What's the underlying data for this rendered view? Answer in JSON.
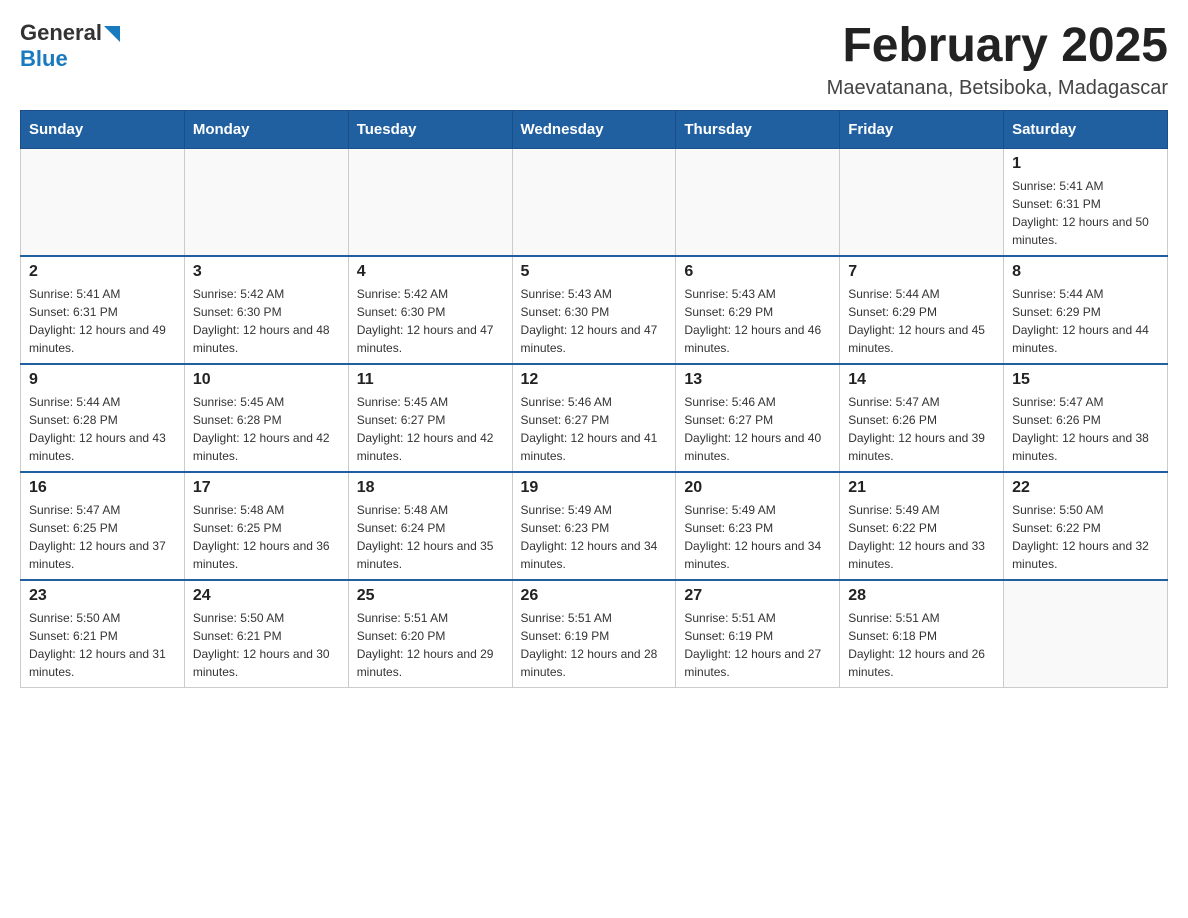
{
  "header": {
    "logo_general": "General",
    "logo_blue": "Blue",
    "title": "February 2025",
    "location": "Maevatanana, Betsiboka, Madagascar"
  },
  "weekdays": [
    "Sunday",
    "Monday",
    "Tuesday",
    "Wednesday",
    "Thursday",
    "Friday",
    "Saturday"
  ],
  "weeks": [
    [
      {
        "day": "",
        "sunrise": "",
        "sunset": "",
        "daylight": ""
      },
      {
        "day": "",
        "sunrise": "",
        "sunset": "",
        "daylight": ""
      },
      {
        "day": "",
        "sunrise": "",
        "sunset": "",
        "daylight": ""
      },
      {
        "day": "",
        "sunrise": "",
        "sunset": "",
        "daylight": ""
      },
      {
        "day": "",
        "sunrise": "",
        "sunset": "",
        "daylight": ""
      },
      {
        "day": "",
        "sunrise": "",
        "sunset": "",
        "daylight": ""
      },
      {
        "day": "1",
        "sunrise": "Sunrise: 5:41 AM",
        "sunset": "Sunset: 6:31 PM",
        "daylight": "Daylight: 12 hours and 50 minutes."
      }
    ],
    [
      {
        "day": "2",
        "sunrise": "Sunrise: 5:41 AM",
        "sunset": "Sunset: 6:31 PM",
        "daylight": "Daylight: 12 hours and 49 minutes."
      },
      {
        "day": "3",
        "sunrise": "Sunrise: 5:42 AM",
        "sunset": "Sunset: 6:30 PM",
        "daylight": "Daylight: 12 hours and 48 minutes."
      },
      {
        "day": "4",
        "sunrise": "Sunrise: 5:42 AM",
        "sunset": "Sunset: 6:30 PM",
        "daylight": "Daylight: 12 hours and 47 minutes."
      },
      {
        "day": "5",
        "sunrise": "Sunrise: 5:43 AM",
        "sunset": "Sunset: 6:30 PM",
        "daylight": "Daylight: 12 hours and 47 minutes."
      },
      {
        "day": "6",
        "sunrise": "Sunrise: 5:43 AM",
        "sunset": "Sunset: 6:29 PM",
        "daylight": "Daylight: 12 hours and 46 minutes."
      },
      {
        "day": "7",
        "sunrise": "Sunrise: 5:44 AM",
        "sunset": "Sunset: 6:29 PM",
        "daylight": "Daylight: 12 hours and 45 minutes."
      },
      {
        "day": "8",
        "sunrise": "Sunrise: 5:44 AM",
        "sunset": "Sunset: 6:29 PM",
        "daylight": "Daylight: 12 hours and 44 minutes."
      }
    ],
    [
      {
        "day": "9",
        "sunrise": "Sunrise: 5:44 AM",
        "sunset": "Sunset: 6:28 PM",
        "daylight": "Daylight: 12 hours and 43 minutes."
      },
      {
        "day": "10",
        "sunrise": "Sunrise: 5:45 AM",
        "sunset": "Sunset: 6:28 PM",
        "daylight": "Daylight: 12 hours and 42 minutes."
      },
      {
        "day": "11",
        "sunrise": "Sunrise: 5:45 AM",
        "sunset": "Sunset: 6:27 PM",
        "daylight": "Daylight: 12 hours and 42 minutes."
      },
      {
        "day": "12",
        "sunrise": "Sunrise: 5:46 AM",
        "sunset": "Sunset: 6:27 PM",
        "daylight": "Daylight: 12 hours and 41 minutes."
      },
      {
        "day": "13",
        "sunrise": "Sunrise: 5:46 AM",
        "sunset": "Sunset: 6:27 PM",
        "daylight": "Daylight: 12 hours and 40 minutes."
      },
      {
        "day": "14",
        "sunrise": "Sunrise: 5:47 AM",
        "sunset": "Sunset: 6:26 PM",
        "daylight": "Daylight: 12 hours and 39 minutes."
      },
      {
        "day": "15",
        "sunrise": "Sunrise: 5:47 AM",
        "sunset": "Sunset: 6:26 PM",
        "daylight": "Daylight: 12 hours and 38 minutes."
      }
    ],
    [
      {
        "day": "16",
        "sunrise": "Sunrise: 5:47 AM",
        "sunset": "Sunset: 6:25 PM",
        "daylight": "Daylight: 12 hours and 37 minutes."
      },
      {
        "day": "17",
        "sunrise": "Sunrise: 5:48 AM",
        "sunset": "Sunset: 6:25 PM",
        "daylight": "Daylight: 12 hours and 36 minutes."
      },
      {
        "day": "18",
        "sunrise": "Sunrise: 5:48 AM",
        "sunset": "Sunset: 6:24 PM",
        "daylight": "Daylight: 12 hours and 35 minutes."
      },
      {
        "day": "19",
        "sunrise": "Sunrise: 5:49 AM",
        "sunset": "Sunset: 6:23 PM",
        "daylight": "Daylight: 12 hours and 34 minutes."
      },
      {
        "day": "20",
        "sunrise": "Sunrise: 5:49 AM",
        "sunset": "Sunset: 6:23 PM",
        "daylight": "Daylight: 12 hours and 34 minutes."
      },
      {
        "day": "21",
        "sunrise": "Sunrise: 5:49 AM",
        "sunset": "Sunset: 6:22 PM",
        "daylight": "Daylight: 12 hours and 33 minutes."
      },
      {
        "day": "22",
        "sunrise": "Sunrise: 5:50 AM",
        "sunset": "Sunset: 6:22 PM",
        "daylight": "Daylight: 12 hours and 32 minutes."
      }
    ],
    [
      {
        "day": "23",
        "sunrise": "Sunrise: 5:50 AM",
        "sunset": "Sunset: 6:21 PM",
        "daylight": "Daylight: 12 hours and 31 minutes."
      },
      {
        "day": "24",
        "sunrise": "Sunrise: 5:50 AM",
        "sunset": "Sunset: 6:21 PM",
        "daylight": "Daylight: 12 hours and 30 minutes."
      },
      {
        "day": "25",
        "sunrise": "Sunrise: 5:51 AM",
        "sunset": "Sunset: 6:20 PM",
        "daylight": "Daylight: 12 hours and 29 minutes."
      },
      {
        "day": "26",
        "sunrise": "Sunrise: 5:51 AM",
        "sunset": "Sunset: 6:19 PM",
        "daylight": "Daylight: 12 hours and 28 minutes."
      },
      {
        "day": "27",
        "sunrise": "Sunrise: 5:51 AM",
        "sunset": "Sunset: 6:19 PM",
        "daylight": "Daylight: 12 hours and 27 minutes."
      },
      {
        "day": "28",
        "sunrise": "Sunrise: 5:51 AM",
        "sunset": "Sunset: 6:18 PM",
        "daylight": "Daylight: 12 hours and 26 minutes."
      },
      {
        "day": "",
        "sunrise": "",
        "sunset": "",
        "daylight": ""
      }
    ]
  ]
}
